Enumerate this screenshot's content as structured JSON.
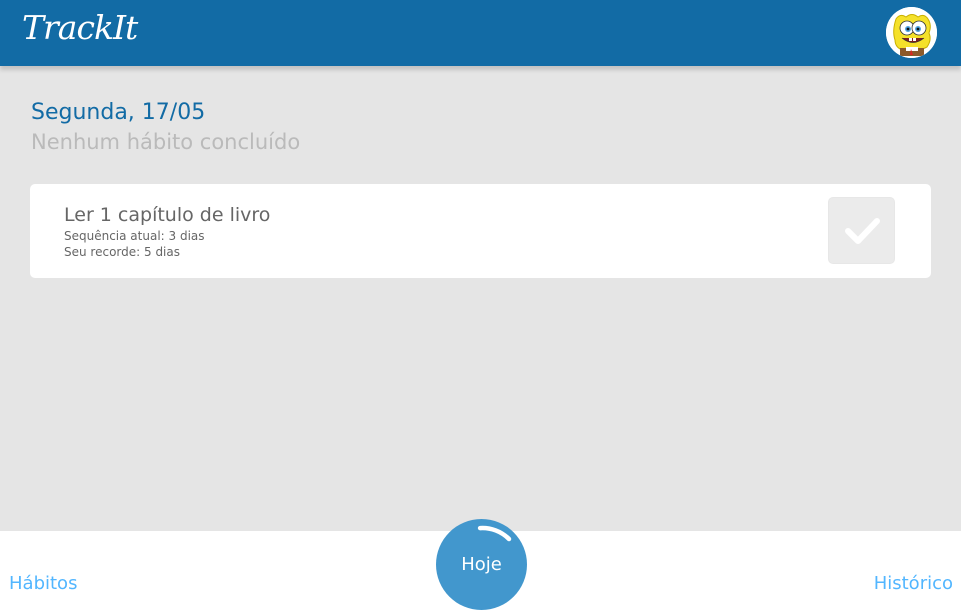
{
  "header": {
    "logo": "TrackIt",
    "avatar_icon": "spongebob-avatar",
    "color": "#126ba5"
  },
  "today": {
    "date": "Segunda, 17/05",
    "summary": "Nenhum hábito concluído"
  },
  "habits": [
    {
      "name": "Ler 1 capítulo de livro",
      "current_sequence": "Sequência atual: 3 dias",
      "record": "Seu recorde: 5 dias",
      "done": false,
      "check_icon": "checkmark-icon"
    }
  ],
  "footer": {
    "habits_label": "Hábitos",
    "today_label": "Hoje",
    "history_label": "Histórico",
    "today_progress": 0.0,
    "link_color": "#52b6ff"
  }
}
